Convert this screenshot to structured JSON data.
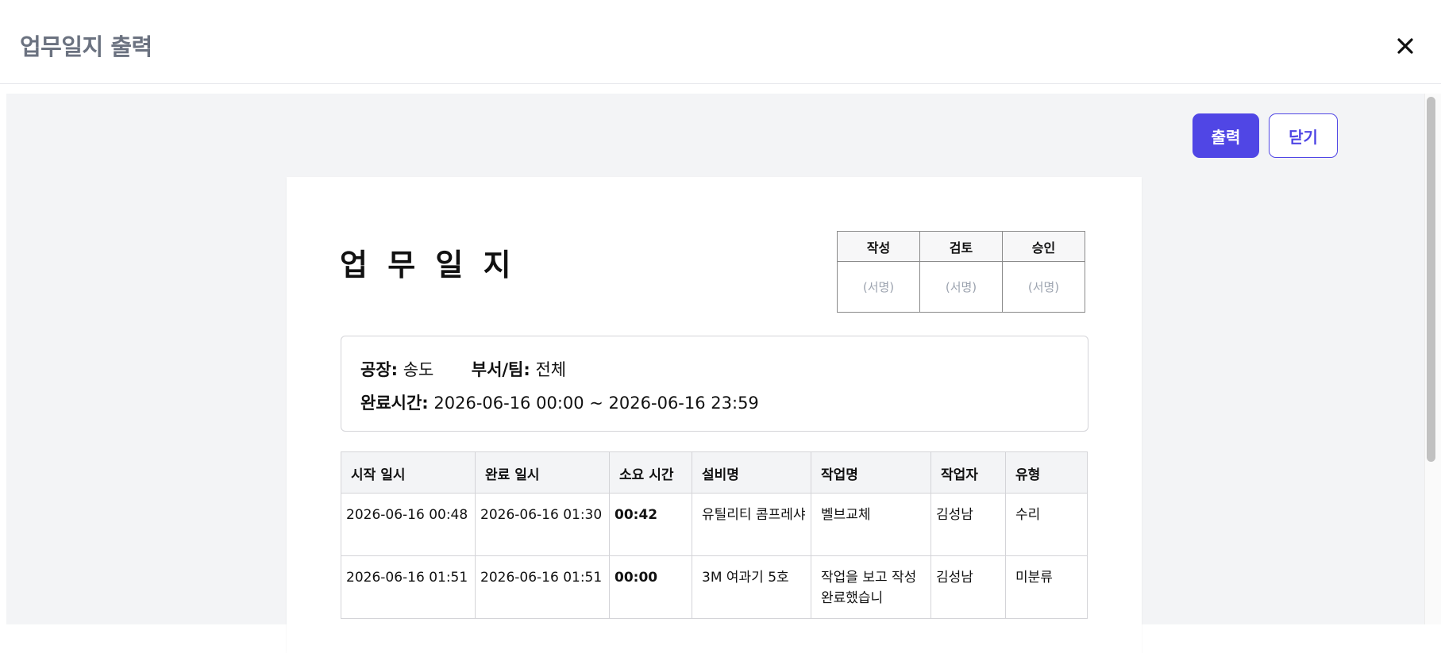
{
  "modal": {
    "title": "업무일지 출력"
  },
  "toolbar": {
    "print_label": "출력",
    "close_label": "닫기",
    "accent_color": "#5046e5"
  },
  "document": {
    "title": "업 무 일 지",
    "approval": {
      "headers": [
        "작성",
        "검토",
        "승인"
      ],
      "placeholder": "(서명)"
    },
    "info": {
      "factory_label": "공장:",
      "factory_value": "송도",
      "dept_label": "부서/팀:",
      "dept_value": "전체",
      "period_label": "완료시간:",
      "period_value": "2026-06-16 00:00 ~ 2026-06-16 23:59"
    },
    "table": {
      "columns": [
        "시작 일시",
        "완료 일시",
        "소요 시간",
        "설비명",
        "작업명",
        "작업자",
        "유형"
      ],
      "rows": [
        [
          "2026-06-16 00:48",
          "2026-06-16 01:30",
          "00:42",
          "유틸리티 콤프레샤",
          "벨브교체",
          "김성남",
          "수리"
        ],
        [
          "2026-06-16 01:51",
          "2026-06-16 01:51",
          "00:00",
          "3M 여과기 5호",
          "작업을 보고 작성 완료했습니",
          "김성남",
          "미분류"
        ]
      ]
    }
  }
}
